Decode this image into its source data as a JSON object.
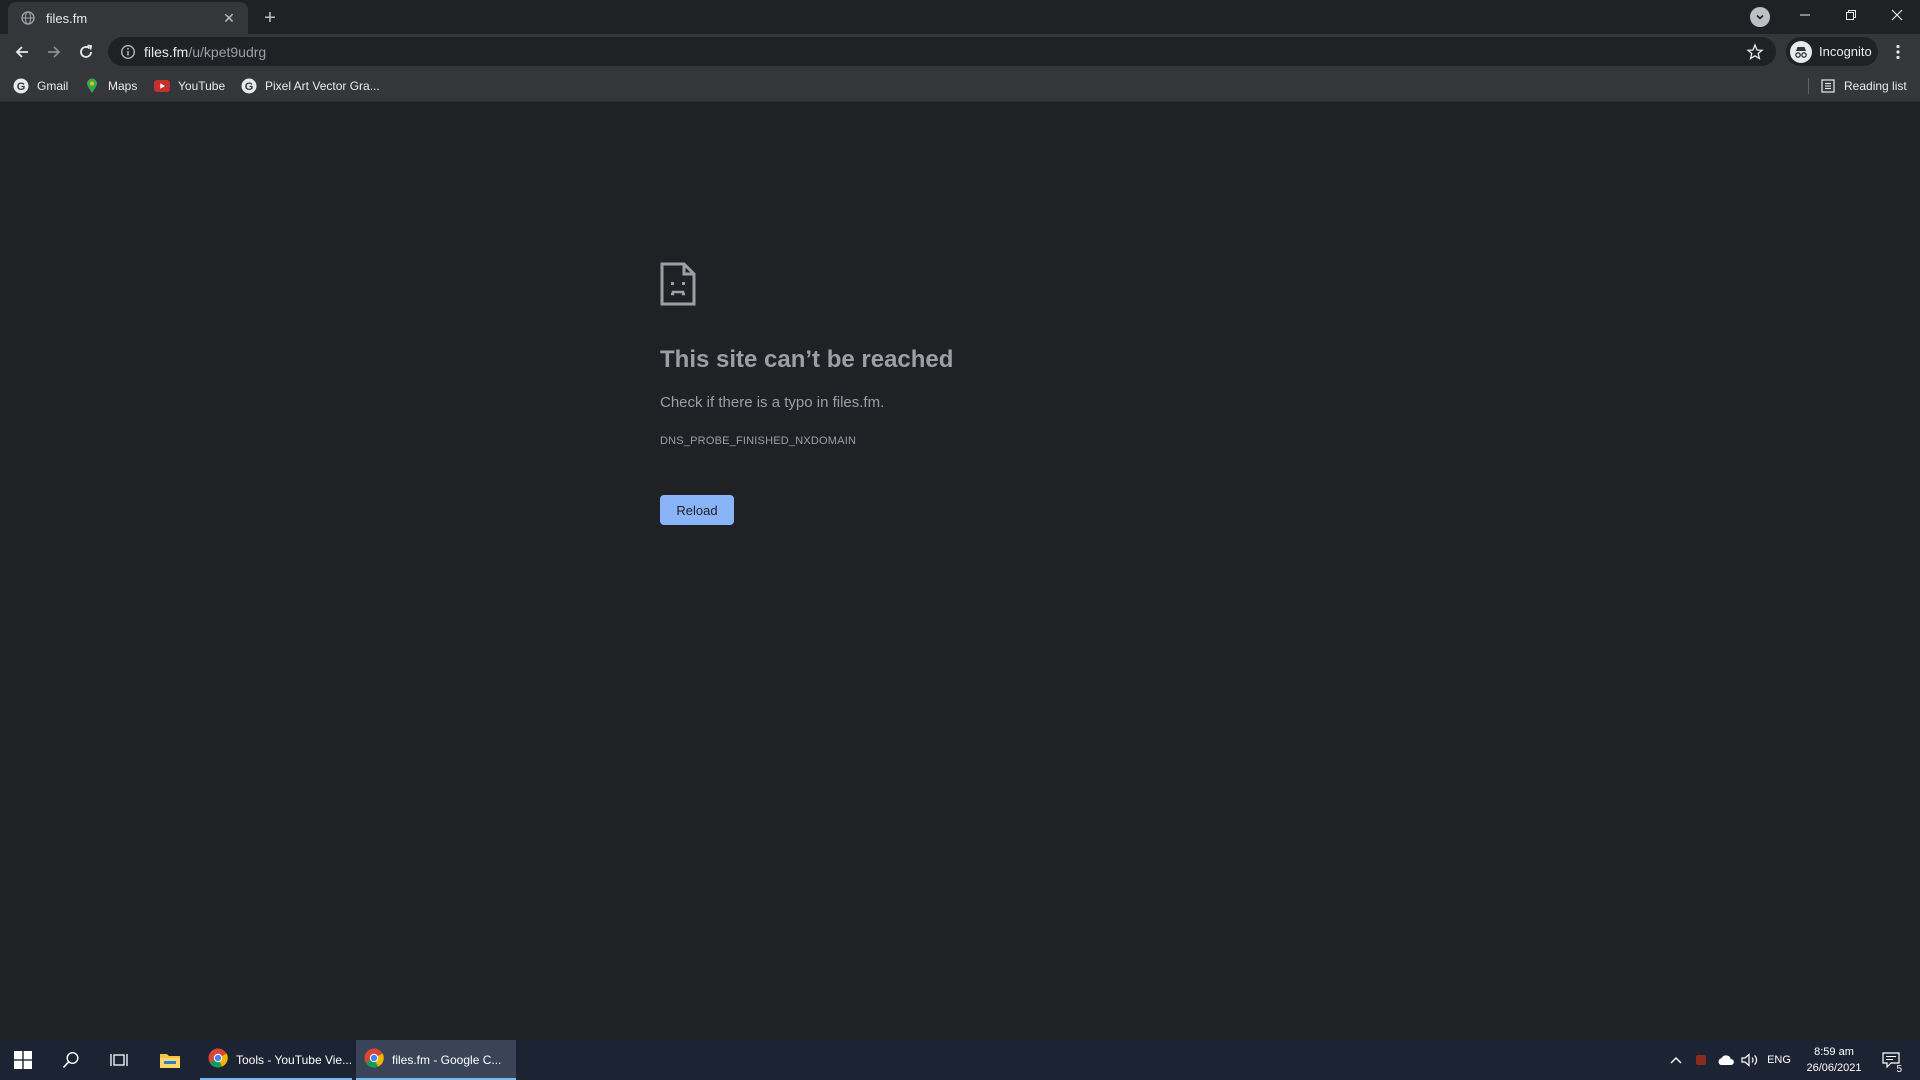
{
  "browser": {
    "tab": {
      "title": "files.fm",
      "close_glyph": "✕",
      "favicon": "globe-icon"
    },
    "new_tab_glyph": "+",
    "omnibox": {
      "url_host": "files.fm",
      "url_path": "/u/kpet9udrg"
    },
    "profile": {
      "label": "Incognito"
    },
    "window_controls": {
      "minimize": "—",
      "restore": "❐",
      "close": "✕"
    }
  },
  "bookmarks": [
    {
      "label": "Gmail",
      "icon": "google-icon"
    },
    {
      "label": "Maps",
      "icon": "maps-pin-icon"
    },
    {
      "label": "YouTube",
      "icon": "youtube-icon"
    },
    {
      "label": "Pixel Art Vector Gra...",
      "icon": "google-icon"
    }
  ],
  "reading_list": {
    "label": "Reading list"
  },
  "error_page": {
    "title": "This site can’t be reached",
    "message": "Check if there is a typo in files.fm.",
    "code": "DNS_PROBE_FINISHED_NXDOMAIN",
    "reload_label": "Reload"
  },
  "taskbar": {
    "apps": [
      {
        "label": "Tools - YouTube Vie..."
      },
      {
        "label": "files.fm - Google C..."
      }
    ],
    "tray": {
      "language": "ENG",
      "time": "8:59 am",
      "date": "26/06/2021",
      "notifications": "5"
    }
  },
  "colors": {
    "page_bg": "#202124",
    "toolbar_bg": "#35363a",
    "accent_button": "#8ab4f8",
    "muted_text": "#9aa0a6",
    "taskbar_bg": "#1c2433"
  }
}
